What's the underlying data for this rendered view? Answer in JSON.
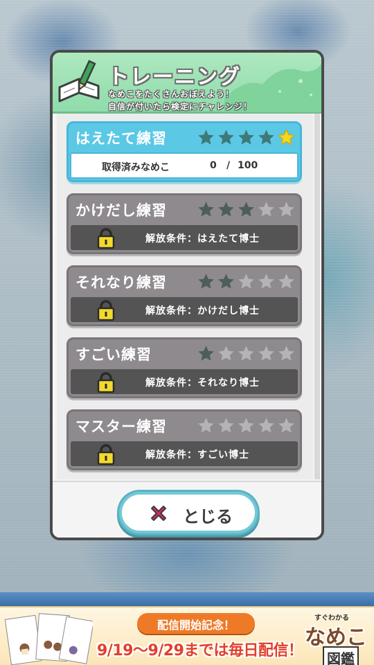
{
  "dialog": {
    "title": "トレーニング",
    "subtitle_line1": "なめこをたくさんおぼえよう！",
    "subtitle_line2": "自信が付いたら検定にチャレンジ！"
  },
  "trainings": [
    {
      "name": "はえたて練習",
      "stars_total": 5,
      "stars_filled": 4,
      "stars_gold": 1,
      "state": "unlocked",
      "progress_label": "取得済みなめこ",
      "progress_count": "0",
      "progress_sep": "/",
      "progress_total": "100"
    },
    {
      "name": "かけだし練習",
      "stars_total": 5,
      "stars_filled": 3,
      "state": "locked",
      "condition": "解放条件：はえたて博士"
    },
    {
      "name": "それなり練習",
      "stars_total": 5,
      "stars_filled": 2,
      "state": "locked",
      "condition": "解放条件：かけだし博士"
    },
    {
      "name": "すごい練習",
      "stars_total": 5,
      "stars_filled": 1,
      "state": "locked",
      "condition": "解放条件：それなり博士"
    },
    {
      "name": "マスター練習",
      "stars_total": 5,
      "stars_filled": 0,
      "state": "locked",
      "condition": "解放条件：すごい博士"
    }
  ],
  "footer": {
    "close_label": "とじる"
  },
  "ad": {
    "pill": "配信開始記念！",
    "dates": "9/19～9/29までは毎日配信！",
    "logo_small": "すぐわかる",
    "logo_main": "なめこ",
    "logo_sub": "図鑑"
  },
  "colors": {
    "active_card": "#5bc8e6",
    "locked_card": "#8f8a8e",
    "star_filled": "#3f7a78",
    "star_empty": "#c9c9c9",
    "star_gold": "#f5d81a",
    "header_green": "#9fe2b5",
    "close_accent": "#d6266e"
  },
  "icons": {
    "header": "notebook-pencil-icon",
    "lock": "padlock-icon",
    "close": "x-mark-icon",
    "star": "star-icon"
  }
}
